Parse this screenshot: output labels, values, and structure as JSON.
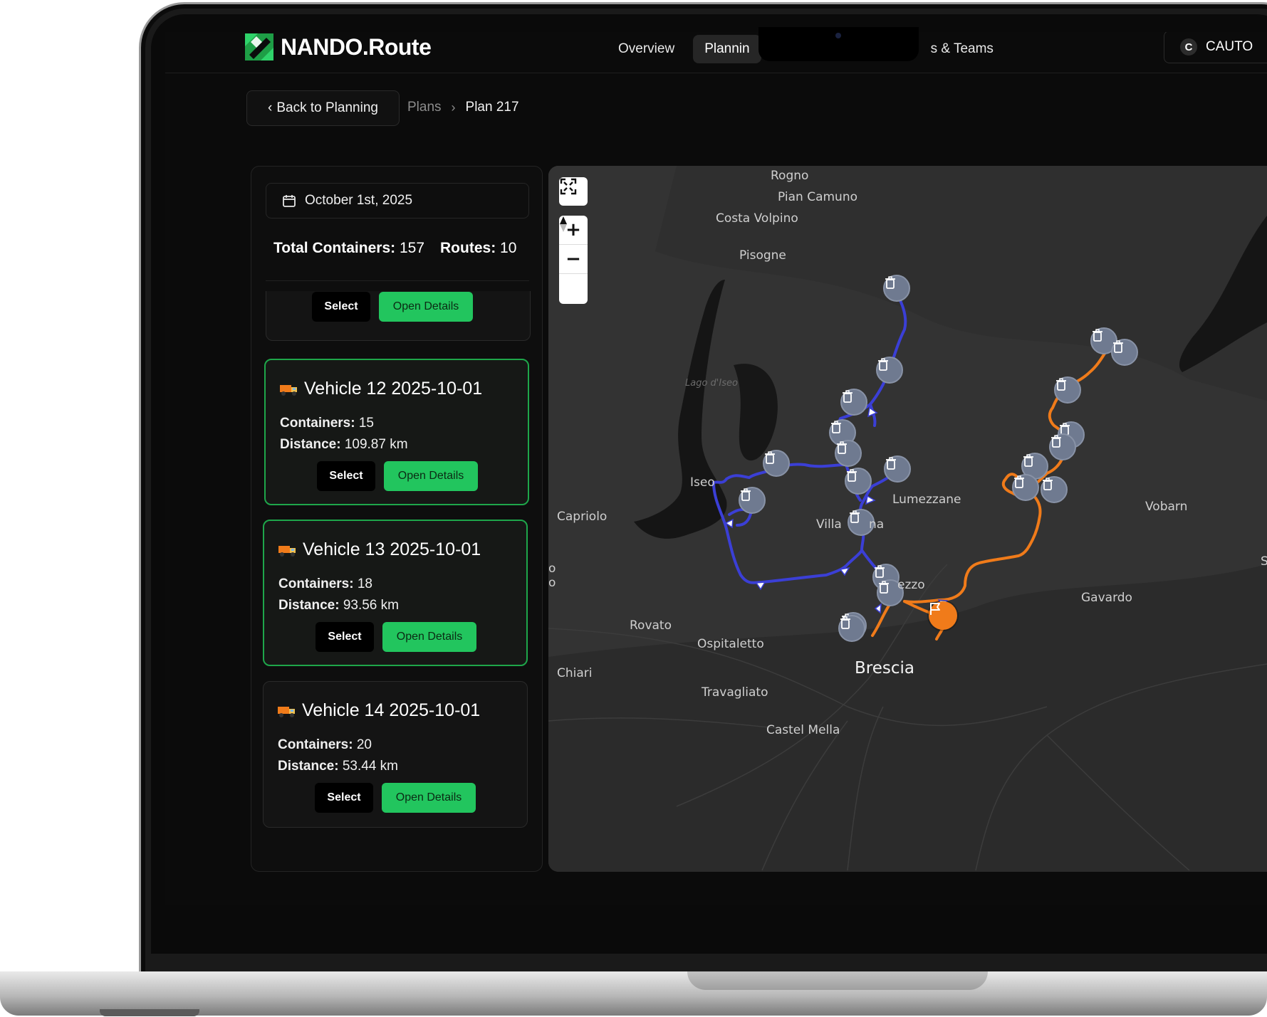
{
  "app": {
    "brand": "NANDO.Route",
    "nav": [
      {
        "label": "Overview"
      },
      {
        "label": "Plannin"
      },
      {
        "label": "s & Teams"
      }
    ],
    "user": {
      "initial": "C",
      "name": "CAUTO"
    }
  },
  "breadcrumb": {
    "back_label": "Back to Planning",
    "items": [
      "Plans",
      "Plan 217"
    ]
  },
  "panel": {
    "date": "October 1st, 2025",
    "total_containers_label": "Total Containers:",
    "total_containers_value": "157",
    "routes_label": "Routes:",
    "routes_value": "10",
    "containers_label": "Containers:",
    "distance_label": "Distance:",
    "select_label": "Select",
    "open_label": "Open Details",
    "vehicles": [
      {
        "title": "Vehicle 12 2025-10-01",
        "containers": "15",
        "distance": "109.87 km"
      },
      {
        "title": "Vehicle 13 2025-10-01",
        "containers": "18",
        "distance": "93.56 km"
      },
      {
        "title": "Vehicle 14 2025-10-01",
        "containers": "20",
        "distance": "53.44 km"
      }
    ]
  },
  "map": {
    "labels": {
      "rogno": "Rogno",
      "pian_camuno": "Pian Camuno",
      "costa_volpino": "Costa Volpino",
      "pisogne": "Pisogne",
      "lago_iseo": "Lago d'Iseo",
      "iseo": "Iseo",
      "capriolo": "Capriolo",
      "villa": "Villa",
      "villa_suffix": "na",
      "lumezzane": "Lumezzane",
      "ezzo": "ezzo",
      "gavardo": "Gavardo",
      "vobarn": "Vobarn",
      "rovato": "Rovato",
      "ospitaletto": "Ospitaletto",
      "chiari": "Chiari",
      "brescia": "Brescia",
      "travagliato": "Travagliato",
      "castel_mella": "Castel Mella",
      "edge_o1": "o",
      "edge_o2": "o",
      "edge_s": "S"
    },
    "route_colors": {
      "blue": "#3b3fd6",
      "orange": "#f07b1a"
    },
    "icons": {
      "fullscreen": "fullscreen-icon",
      "zoom_in": "plus-icon",
      "zoom_out": "minus-icon",
      "compass": "compass-icon",
      "stop": "trash-bin-icon",
      "depot": "flag-icon"
    }
  },
  "colors": {
    "accent_green": "#22c55e",
    "card_border_green": "#1ea64a"
  }
}
